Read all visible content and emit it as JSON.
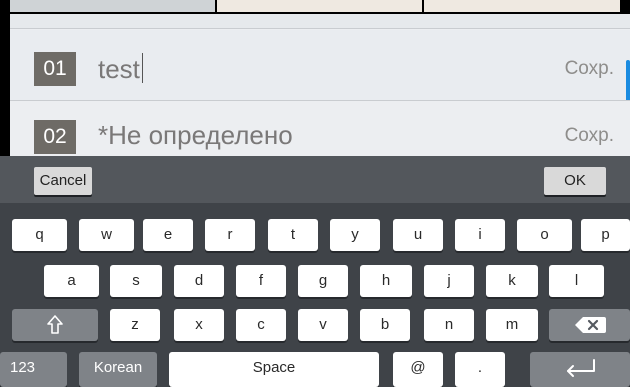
{
  "entries": [
    {
      "number": "01",
      "text": "test",
      "save_label": "Сохр."
    },
    {
      "number": "02",
      "text": "*Не определено",
      "save_label": "Сохр."
    }
  ],
  "keyboard": {
    "cancel_label": "Cancel",
    "ok_label": "OK",
    "row1": [
      "q",
      "w",
      "e",
      "r",
      "t",
      "y",
      "u",
      "i",
      "o",
      "p"
    ],
    "row2": [
      "a",
      "s",
      "d",
      "f",
      "g",
      "h",
      "j",
      "k",
      "l"
    ],
    "row3": [
      "z",
      "x",
      "c",
      "v",
      "b",
      "n",
      "m"
    ],
    "numeric_label": "123",
    "language_label": "Korean",
    "space_label": "Space",
    "at_label": "@",
    "dot_label": ".",
    "icons": {
      "shift": "shift-icon",
      "backspace": "backspace-icon",
      "enter": "enter-icon"
    }
  },
  "colors": {
    "accent": "#1a8be0",
    "number_badge": "#6e6b66",
    "keyboard_bg": "#3f4348"
  }
}
